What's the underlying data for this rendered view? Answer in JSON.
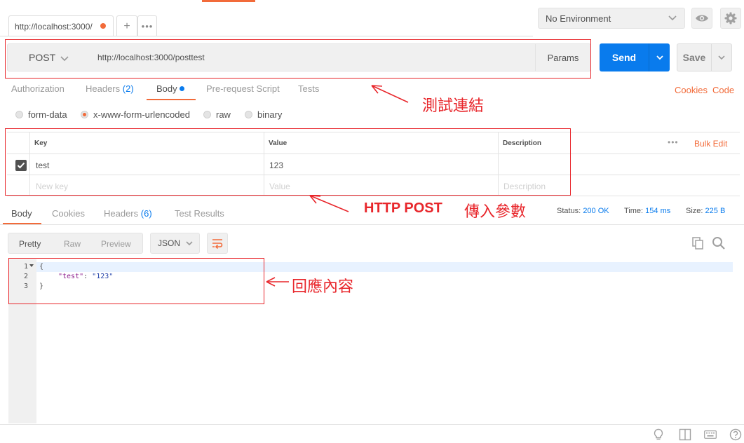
{
  "tabs": {
    "active_tab_label": "http://localhost:3000/",
    "add_symbol": "+",
    "more_symbol": "•••"
  },
  "environment": {
    "selected": "No Environment"
  },
  "request": {
    "method": "POST",
    "url": "http://localhost:3000/posttest",
    "params_label": "Params",
    "send_label": "Send",
    "save_label": "Save"
  },
  "request_tabs": {
    "authorization": "Authorization",
    "headers": "Headers",
    "headers_count": "(2)",
    "body": "Body",
    "prerequest": "Pre-request Script",
    "tests": "Tests",
    "cookies_link": "Cookies",
    "code_link": "Code"
  },
  "body_modes": {
    "form_data": "form-data",
    "urlencoded": "x-www-form-urlencoded",
    "raw": "raw",
    "binary": "binary",
    "selected": "x-www-form-urlencoded"
  },
  "kv_table": {
    "headers": [
      "Key",
      "Value",
      "Description"
    ],
    "bulk_edit": "Bulk Edit",
    "more": "•••",
    "rows": [
      {
        "key": "test",
        "value": "123",
        "description": "",
        "checked": true
      }
    ],
    "placeholder": {
      "key": "New key",
      "value": "Value",
      "description": "Description"
    }
  },
  "response_tabs": {
    "body": "Body",
    "cookies": "Cookies",
    "headers": "Headers",
    "headers_count": "(6)",
    "test_results": "Test Results"
  },
  "response_meta": {
    "status_label": "Status:",
    "status_value": "200 OK",
    "time_label": "Time:",
    "time_value": "154 ms",
    "size_label": "Size:",
    "size_value": "225 B"
  },
  "response_toolbar": {
    "pretty": "Pretty",
    "raw": "Raw",
    "preview": "Preview",
    "format": "JSON"
  },
  "response_body": {
    "line_numbers": [
      "1",
      "2",
      "3"
    ],
    "open_brace": "{",
    "key": "\"test\"",
    "colon": ": ",
    "value": "\"123\"",
    "close_brace": "}"
  },
  "annotations": {
    "url_note": "測試連結",
    "params_note_bold": "HTTP POST",
    "params_note": "傳入參數",
    "response_note": "回應內容",
    "color": "#e8262b"
  },
  "colors": {
    "accent_orange": "#f26b3a",
    "primary_blue": "#097bed"
  }
}
